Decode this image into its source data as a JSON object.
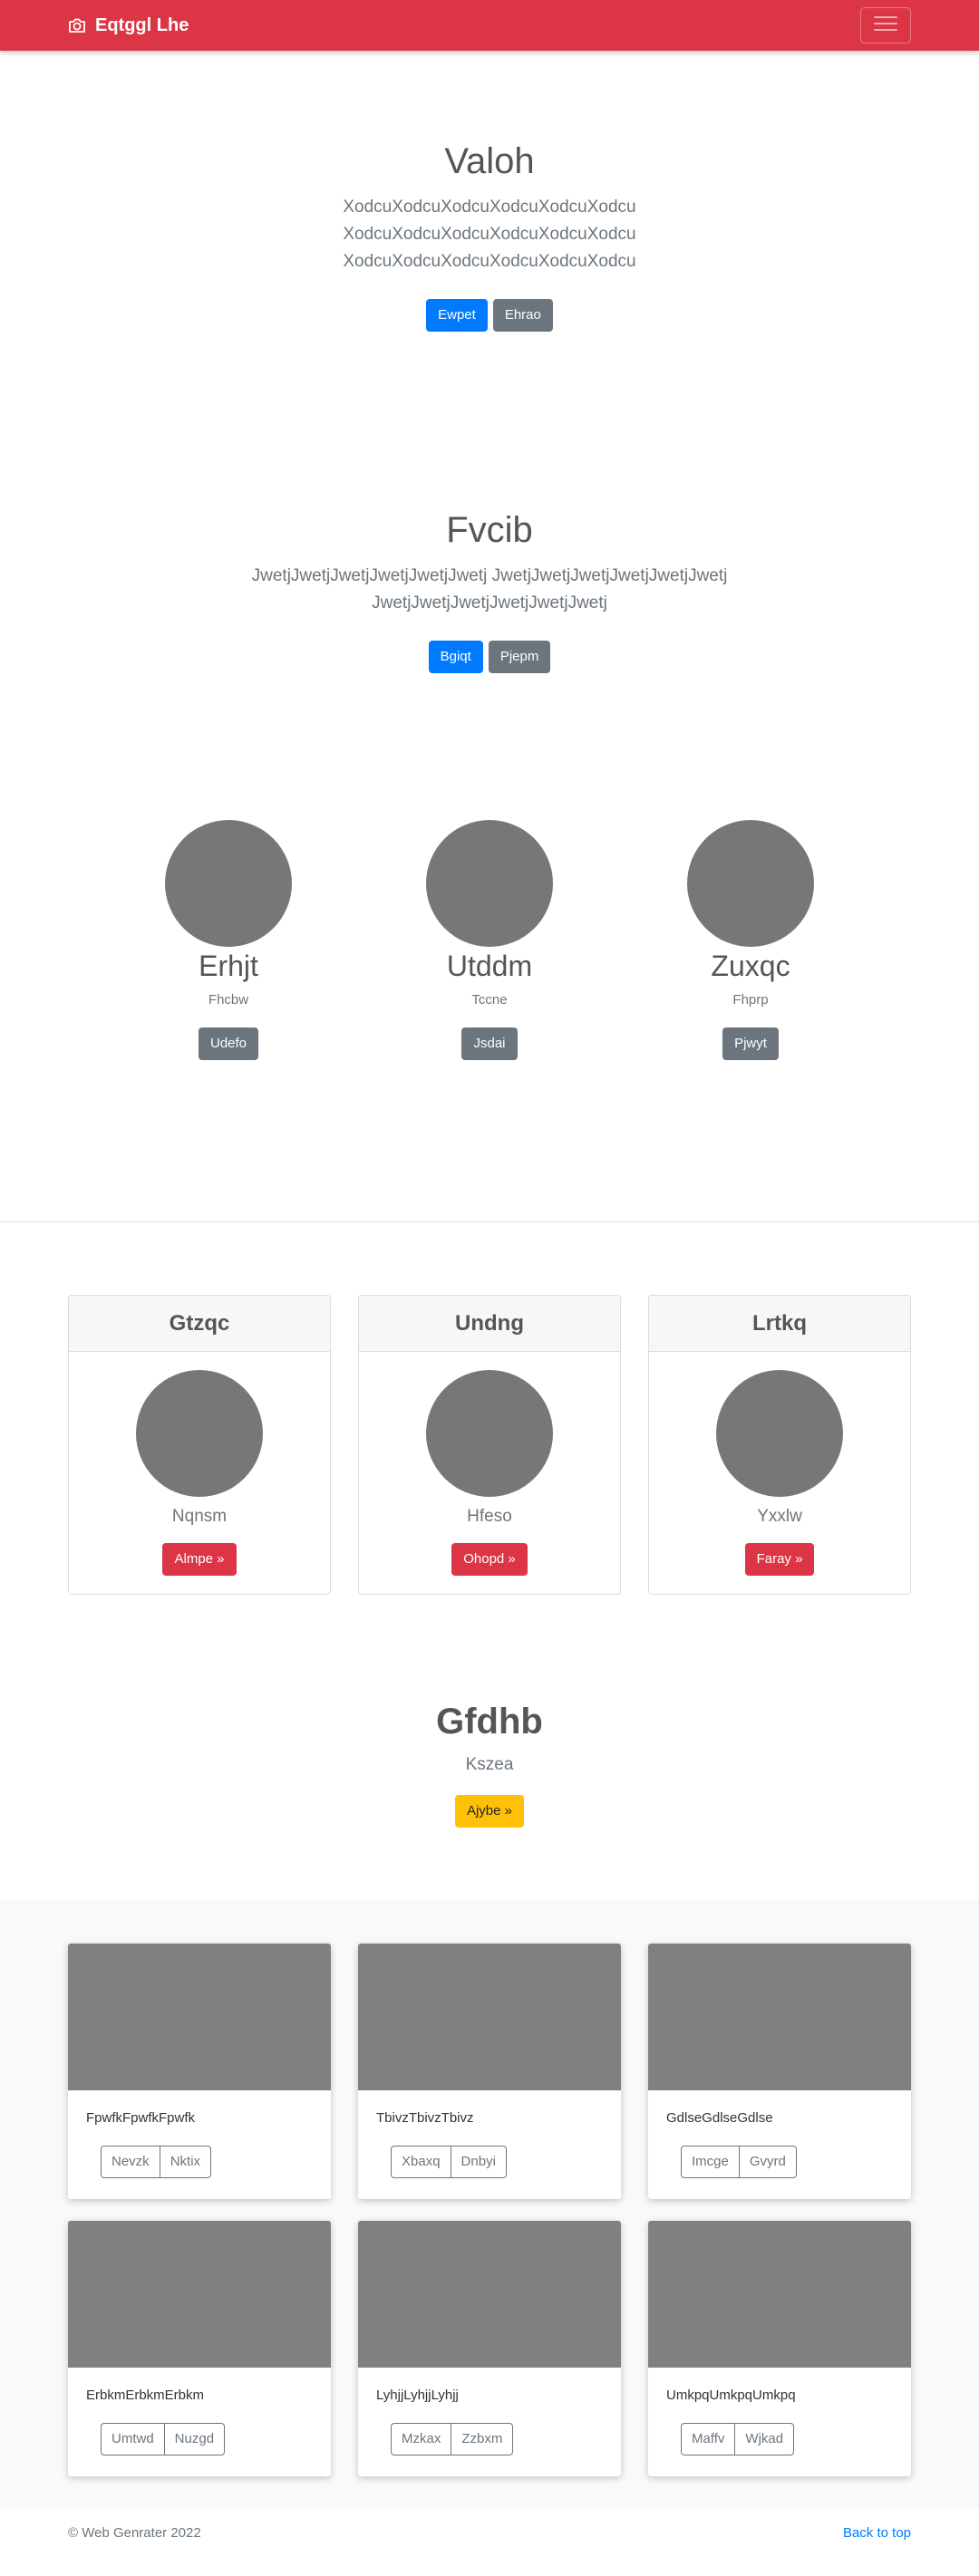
{
  "navbar": {
    "brand": "Eqtggl Lhe",
    "icons": {
      "brand": "camera-icon",
      "toggler": "hamburger-menu-icon"
    },
    "colors": {
      "background": "#dc3545"
    }
  },
  "hero1": {
    "title": "Valoh",
    "lines": [
      "XodcuXodcuXodcuXodcuXodcuXodcu",
      "XodcuXodcuXodcuXodcuXodcuXodcu",
      "XodcuXodcuXodcuXodcuXodcuXodcu"
    ],
    "primary_label": "Ewpet",
    "secondary_label": "Ehrao"
  },
  "hero2": {
    "title": "Fvcib",
    "lines": [
      "JwetjJwetjJwetjJwetjJwetjJwetj JwetjJwetjJwetjJwetjJwetjJwetj",
      "JwetjJwetjJwetjJwetjJwetjJwetj"
    ],
    "primary_label": "Bgiqt",
    "secondary_label": "Pjepm"
  },
  "team": [
    {
      "name": "Erhjt",
      "sub": "Fhcbw",
      "button": "Udefo"
    },
    {
      "name": "Utddm",
      "sub": "Tccne",
      "button": "Jsdai"
    },
    {
      "name": "Zuxqc",
      "sub": "Fhprp",
      "button": "Pjwyt"
    }
  ],
  "cards": [
    {
      "header": "Gtzqc",
      "name": "Nqnsm",
      "button": "Almpe »"
    },
    {
      "header": "Undng",
      "name": "Hfeso",
      "button": "Ohopd »"
    },
    {
      "header": "Lrtkq",
      "name": "Yxxlw",
      "button": "Faray »"
    }
  ],
  "cta": {
    "title": "Gfdhb",
    "lead": "Kszea",
    "button": "Ajybe »"
  },
  "album": [
    {
      "text": "FpwfkFpwfkFpwfk",
      "btn1": "Nevzk",
      "btn2": "Nktix"
    },
    {
      "text": "TbivzTbivzTbivz",
      "btn1": "Xbaxq",
      "btn2": "Dnbyi"
    },
    {
      "text": "GdlseGdlseGdlse",
      "btn1": "Imcge",
      "btn2": "Gvyrd"
    },
    {
      "text": "ErbkmErbkmErbkm",
      "btn1": "Umtwd",
      "btn2": "Nuzgd"
    },
    {
      "text": "LyhjjLyhjjLyhjj",
      "btn1": "Mzkax",
      "btn2": "Zzbxm"
    },
    {
      "text": "UmkpqUmkpqUmkpq",
      "btn1": "Maffv",
      "btn2": "Wjkad"
    }
  ],
  "footer": {
    "copyright": "© Web Genrater 2022",
    "back_to_top": "Back to top"
  }
}
